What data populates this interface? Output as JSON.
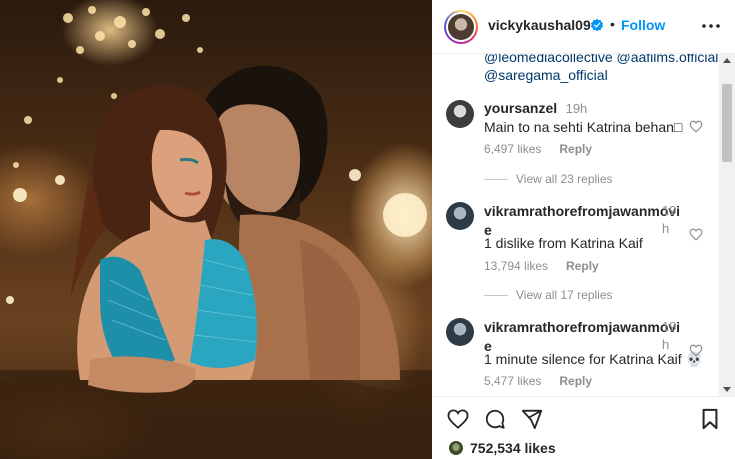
{
  "post": {
    "username": "vickykaushal09",
    "separator": "•",
    "follow_label": "Follow",
    "caption_tail": [
      "@leomediacollective @aafilms.official",
      "@saregama_official"
    ]
  },
  "comments": [
    {
      "user": "yoursanzel",
      "time": "19h",
      "text": "Main to na sehti Katrina behan□",
      "likes": "6,497 likes",
      "reply": "Reply",
      "replies": "View all 23 replies"
    },
    {
      "user_line1": "vikramrathorefromjawanmovi",
      "user_line2": "e",
      "time_line1": "19",
      "time_line2": "h",
      "text": "1 dislike from Katrina Kaif",
      "likes": "13,794 likes",
      "reply": "Reply",
      "replies": "View all 17 replies"
    },
    {
      "user_line1": "vikramrathorefromjawanmovi",
      "user_line2": "e",
      "time_line1": "19",
      "time_line2": "h",
      "text": "1 minute silence for Katrina Kaif 💀",
      "likes": "5,477 likes",
      "reply": "Reply"
    }
  ],
  "footer": {
    "likes_count": "752,534 likes"
  },
  "icons": [
    "verified-badge-icon",
    "more-options-icon",
    "heart-icon",
    "comment-icon",
    "share-icon",
    "bookmark-icon"
  ],
  "colors": {
    "link_blue": "#0095f6",
    "mention_blue": "#00376b",
    "muted_gray": "#8e8e8e",
    "text_dark": "#262626"
  }
}
